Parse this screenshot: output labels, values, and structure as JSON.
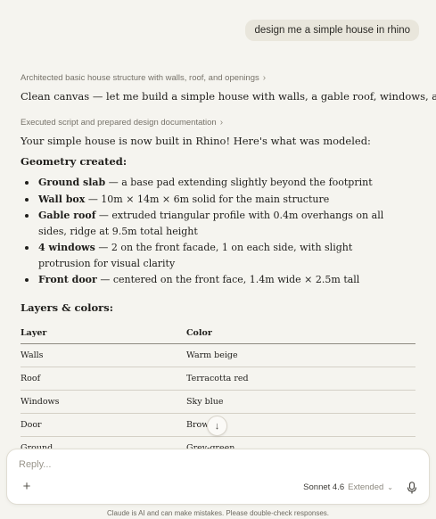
{
  "user_message": "design me a simple house in rhino",
  "steps": [
    {
      "label": "Architected basic house structure with walls, roof, and openings"
    },
    {
      "label": "Executed script and prepared design documentation"
    }
  ],
  "intro": "Clean canvas — let me build a simple house with walls, a gable roof, windows, and a door.",
  "summary": "Your simple house is now built in Rhino! Here's what was modeled:",
  "geometry_heading": "Geometry created:",
  "geometry_items": [
    {
      "title": "Ground slab",
      "desc": "— a base pad extending slightly beyond the footprint"
    },
    {
      "title": "Wall box",
      "desc": "— 10m × 14m × 6m solid for the main structure"
    },
    {
      "title": "Gable roof",
      "desc": "— extruded triangular profile with 0.4m overhangs on all sides, ridge at 9.5m total height"
    },
    {
      "title": "4 windows",
      "desc": "— 2 on the front facade, 1 on each side, with slight protrusion for visual clarity"
    },
    {
      "title": "Front door",
      "desc": "— centered on the front face, 1.4m wide × 2.5m tall"
    }
  ],
  "layers_heading": "Layers & colors:",
  "table": {
    "headers": [
      "Layer",
      "Color"
    ],
    "rows": [
      [
        "Walls",
        "Warm beige"
      ],
      [
        "Roof",
        "Terracotta red"
      ],
      [
        "Windows",
        "Sky blue"
      ],
      [
        "Door",
        "Brown"
      ],
      [
        "Ground",
        "Grey-green"
      ]
    ]
  },
  "composer": {
    "placeholder": "Reply...",
    "model": "Sonnet 4.6",
    "mode": "Extended"
  },
  "disclaimer": "Claude is AI and can make mistakes. Please double-check responses.",
  "icons": {
    "step_chevron": "chevron-right-icon",
    "scroll": "arrow-down-icon",
    "add": "plus-icon",
    "mic": "microphone-icon"
  }
}
